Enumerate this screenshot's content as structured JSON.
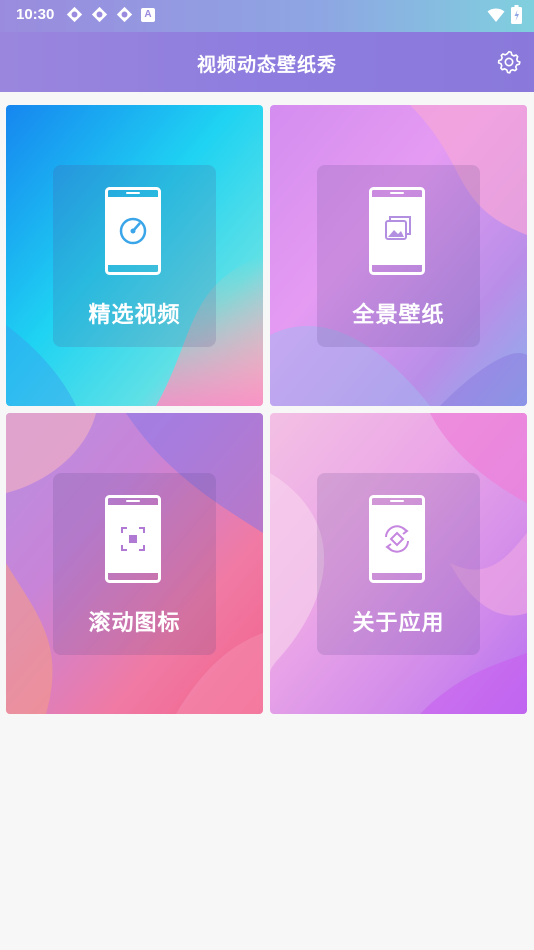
{
  "status_bar": {
    "time": "10:30",
    "letter_icon": "A",
    "icons_left": [
      "notification-icon",
      "notification-icon",
      "notification-icon",
      "a-icon"
    ],
    "icons_right": [
      "wifi-icon",
      "battery-icon"
    ]
  },
  "app_bar": {
    "title": "视频动态壁纸秀",
    "settings_icon": "gear-icon"
  },
  "tiles": [
    {
      "label": "精选视频",
      "icon": "video-dial-icon"
    },
    {
      "label": "全景壁纸",
      "icon": "image-gallery-icon"
    },
    {
      "label": "滚动图标",
      "icon": "focus-frame-icon"
    },
    {
      "label": "关于应用",
      "icon": "rotate-diamond-icon"
    }
  ]
}
